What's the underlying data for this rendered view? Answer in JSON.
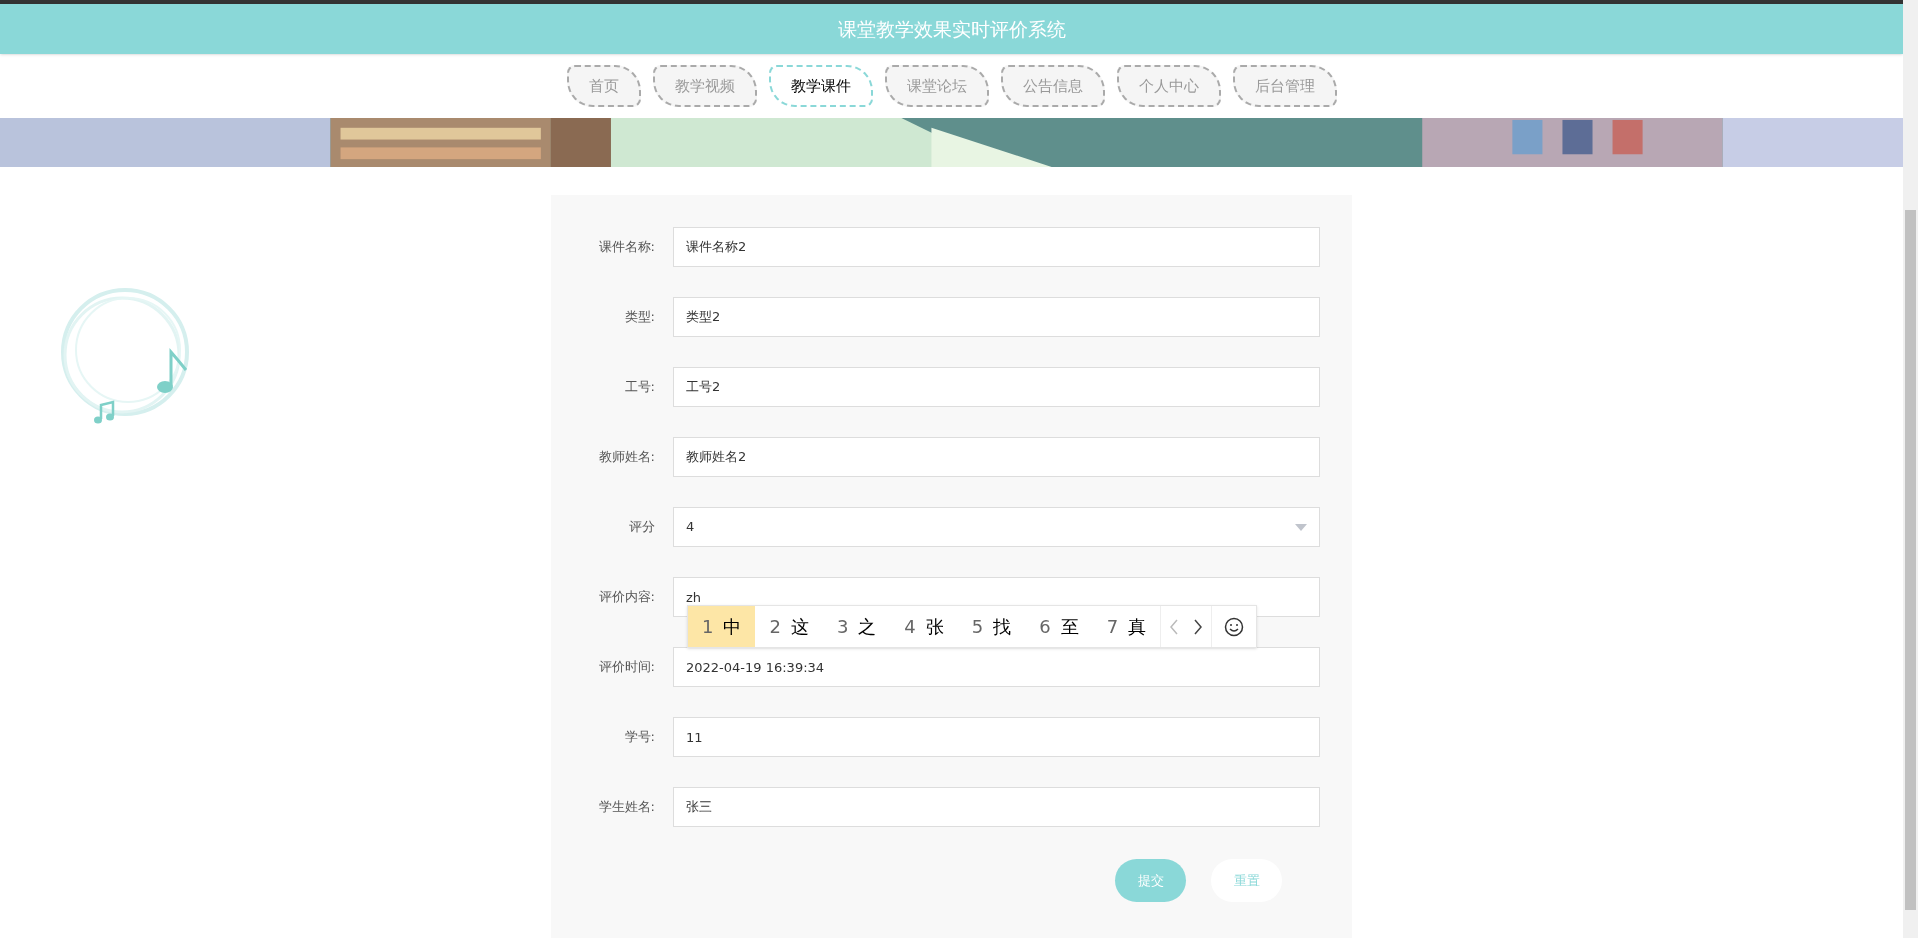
{
  "header": {
    "title": "课堂教学效果实时评价系统"
  },
  "nav": [
    {
      "label": "首页",
      "selected": false
    },
    {
      "label": "教学视频",
      "selected": false
    },
    {
      "label": "教学课件",
      "selected": true
    },
    {
      "label": "课堂论坛",
      "selected": false
    },
    {
      "label": "公告信息",
      "selected": false
    },
    {
      "label": "个人中心",
      "selected": false
    },
    {
      "label": "后台管理",
      "selected": false
    }
  ],
  "form": {
    "fields": [
      {
        "kind": "input",
        "label": "课件名称:",
        "value": "课件名称2"
      },
      {
        "kind": "input",
        "label": "类型:",
        "value": "类型2"
      },
      {
        "kind": "input",
        "label": "工号:",
        "value": "工号2"
      },
      {
        "kind": "input",
        "label": "教师姓名:",
        "value": "教师姓名2"
      },
      {
        "kind": "select",
        "label": "评分",
        "value": "4"
      },
      {
        "kind": "input",
        "label": "评价内容:",
        "value": "zh"
      },
      {
        "kind": "input",
        "label": "评价时间:",
        "value": "2022-04-19 16:39:34"
      },
      {
        "kind": "input",
        "label": "学号:",
        "value": "11"
      },
      {
        "kind": "input",
        "label": "学生姓名:",
        "value": "张三"
      }
    ],
    "buttons": [
      {
        "label": "提交",
        "kind": "primary"
      },
      {
        "label": "重置",
        "kind": "secondary"
      }
    ]
  },
  "ime": {
    "candidates": [
      {
        "index": "1",
        "text": "中",
        "selected": true
      },
      {
        "index": "2",
        "text": "这",
        "selected": false
      },
      {
        "index": "3",
        "text": "之",
        "selected": false
      },
      {
        "index": "4",
        "text": "张",
        "selected": false
      },
      {
        "index": "5",
        "text": "找",
        "selected": false
      },
      {
        "index": "6",
        "text": "至",
        "selected": false
      },
      {
        "index": "7",
        "text": "真",
        "selected": false
      }
    ]
  }
}
